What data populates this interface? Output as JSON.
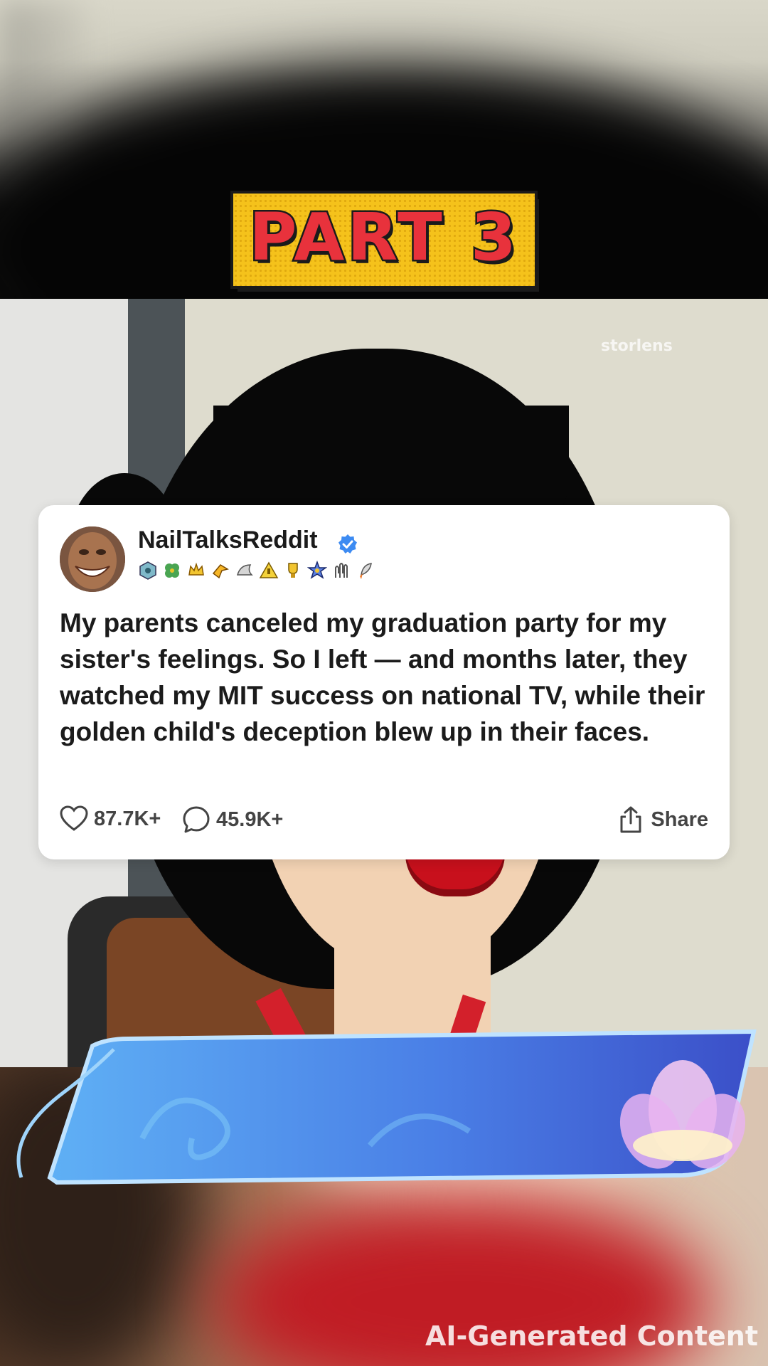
{
  "banner": {
    "label": "PART 3"
  },
  "watermark": "storlens",
  "post": {
    "username": "NailTalksReddit",
    "verified": true,
    "badge_icons": [
      "hex-badge-icon",
      "clover-badge-icon",
      "crown-badge-icon",
      "arrow-badge-icon",
      "wing-badge-icon",
      "triangle-badge-icon",
      "trophy-badge-icon",
      "star-badge-icon",
      "hands-badge-icon",
      "rocket-badge-icon"
    ],
    "text": "My parents canceled my graduation party for my sister's feelings. So I left — and months later, they watched my MIT success on national TV, while their golden child's deception blew up in their faces.",
    "likes": "87.7K+",
    "comments": "45.9K+",
    "share_label": "Share"
  },
  "footer_label": "AI-Generated Content",
  "colors": {
    "banner_yellow": "#f5c21b",
    "banner_red": "#e8323c",
    "verified_blue": "#3d8bf2",
    "text_dark": "#1b1b1b",
    "frame_blue": "#3f8fe8"
  }
}
